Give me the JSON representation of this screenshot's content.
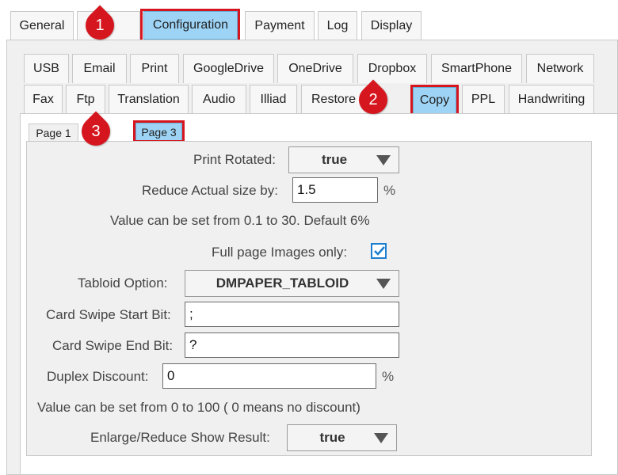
{
  "top_tabs": [
    {
      "label": "General"
    },
    {
      "label": ""
    },
    {
      "label": "Configuration",
      "selected": true
    },
    {
      "label": "Payment"
    },
    {
      "label": "Log"
    },
    {
      "label": "Display"
    }
  ],
  "sub_tabs_row1": [
    "USB",
    "Email",
    "Print",
    "GoogleDrive",
    "OneDrive",
    "Dropbox",
    "SmartPhone",
    "Network"
  ],
  "sub_tabs_row2": [
    "Fax",
    "Ftp",
    "Translation",
    "Audio",
    "Illiad",
    "Restore",
    "Copy",
    "PPL",
    "Handwriting"
  ],
  "page_tabs": [
    "Page 1",
    "Page 3"
  ],
  "badges": [
    "1",
    "2",
    "3"
  ],
  "form": {
    "print_rotated_label": "Print Rotated:",
    "print_rotated_value": "true",
    "reduce_label": "Reduce Actual size by:",
    "reduce_value": "1.5",
    "reduce_unit": "%",
    "reduce_hint": "Value can be set from 0.1 to 30. Default 6%",
    "fullpage_label": "Full page Images only:",
    "fullpage_checked": true,
    "tabloid_label": "Tabloid Option:",
    "tabloid_value": "DMPAPER_TABLOID",
    "card_start_label": "Card Swipe Start Bit:",
    "card_start_value": ";",
    "card_end_label": "Card Swipe End Bit:",
    "card_end_value": "?",
    "duplex_label": "Duplex Discount:",
    "duplex_value": "0",
    "duplex_unit": "%",
    "duplex_hint": "Value can be set from 0 to 100 ( 0 means no discount)",
    "enlarge_label": "Enlarge/Reduce Show Result:",
    "enlarge_value": "true"
  },
  "colors": {
    "selected_tab": "#9dd3f5",
    "annotation_red": "#d6161e",
    "checkbox_blue": "#1d7fd0"
  }
}
